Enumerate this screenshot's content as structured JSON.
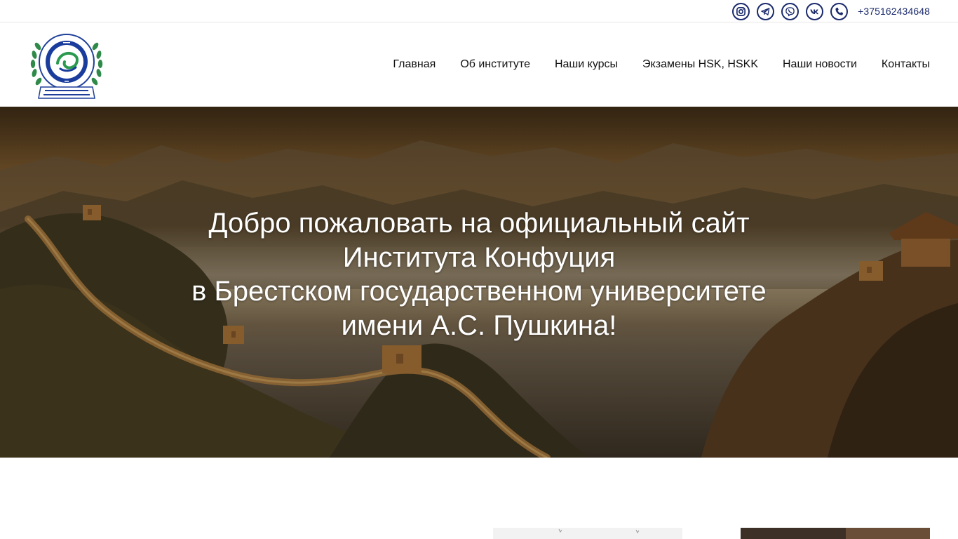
{
  "topbar": {
    "icons": [
      "instagram-icon",
      "telegram-icon",
      "viber-icon",
      "vk-icon",
      "phone-icon"
    ],
    "phone": "+375162434648",
    "icon_color": "#1a2a6c"
  },
  "header": {
    "logo_alt": "Институт Конфуция"
  },
  "nav": {
    "items": [
      {
        "label": "Главная"
      },
      {
        "label": "Об институте"
      },
      {
        "label": "Наши курсы"
      },
      {
        "label": "Экзамены HSK, HSKK"
      },
      {
        "label": "Наши новости"
      },
      {
        "label": "Контакты"
      }
    ]
  },
  "hero": {
    "title_lines": [
      "Добро пожаловать на официальный сайт",
      "Института Конфуция",
      "в Брестском государственном университете",
      "имени А.С. Пушкина!"
    ]
  },
  "colors": {
    "accent": "#1a2a6c",
    "text": "#111111",
    "hero_text": "#ffffff"
  }
}
